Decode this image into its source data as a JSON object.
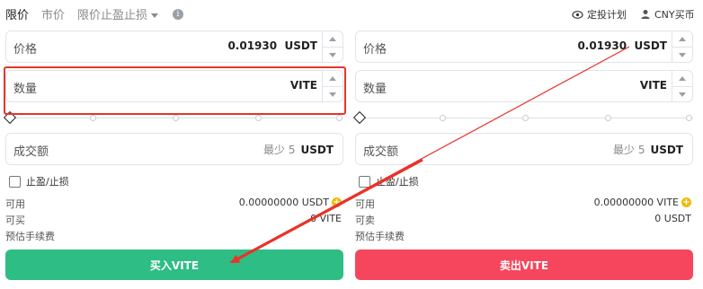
{
  "tabs": [
    {
      "label": "限价",
      "active": true
    },
    {
      "label": "市价",
      "active": false
    },
    {
      "label": "限价止盈止损",
      "active": false,
      "dropdown": true
    }
  ],
  "top_right": {
    "plan_icon": "eye-target-icon",
    "plan_label": "定投计划",
    "fiat_icon": "person-icon",
    "fiat_label": "CNY买币"
  },
  "buy": {
    "price": {
      "label": "价格",
      "value": "0.01930",
      "unit": "USDT"
    },
    "quantity": {
      "label": "数量",
      "unit": "VITE"
    },
    "amount": {
      "label": "成交额",
      "hint": "最少 5",
      "unit": "USDT"
    },
    "tpsl_label": "止盈/止损",
    "available": {
      "label": "可用",
      "value": "0.00000000 USDT"
    },
    "buyable": {
      "label": "可买",
      "value": "0 VITE"
    },
    "fee": {
      "label": "预估手续费"
    },
    "button_label": "买入VITE",
    "button_color": "#2ebd85"
  },
  "sell": {
    "price": {
      "label": "价格",
      "value": "0.01930",
      "unit": "USDT"
    },
    "quantity": {
      "label": "数量",
      "unit": "VITE"
    },
    "amount": {
      "label": "成交额",
      "hint": "最少 5",
      "unit": "USDT"
    },
    "tpsl_label": "止盈/止损",
    "available": {
      "label": "可用",
      "value": "0.00000000 VITE"
    },
    "sellable": {
      "label": "可卖",
      "value": "0 USDT"
    },
    "fee": {
      "label": "预估手续费"
    },
    "button_label": "卖出VITE",
    "button_color": "#f6465d"
  },
  "annotation_color": "#e8332a"
}
